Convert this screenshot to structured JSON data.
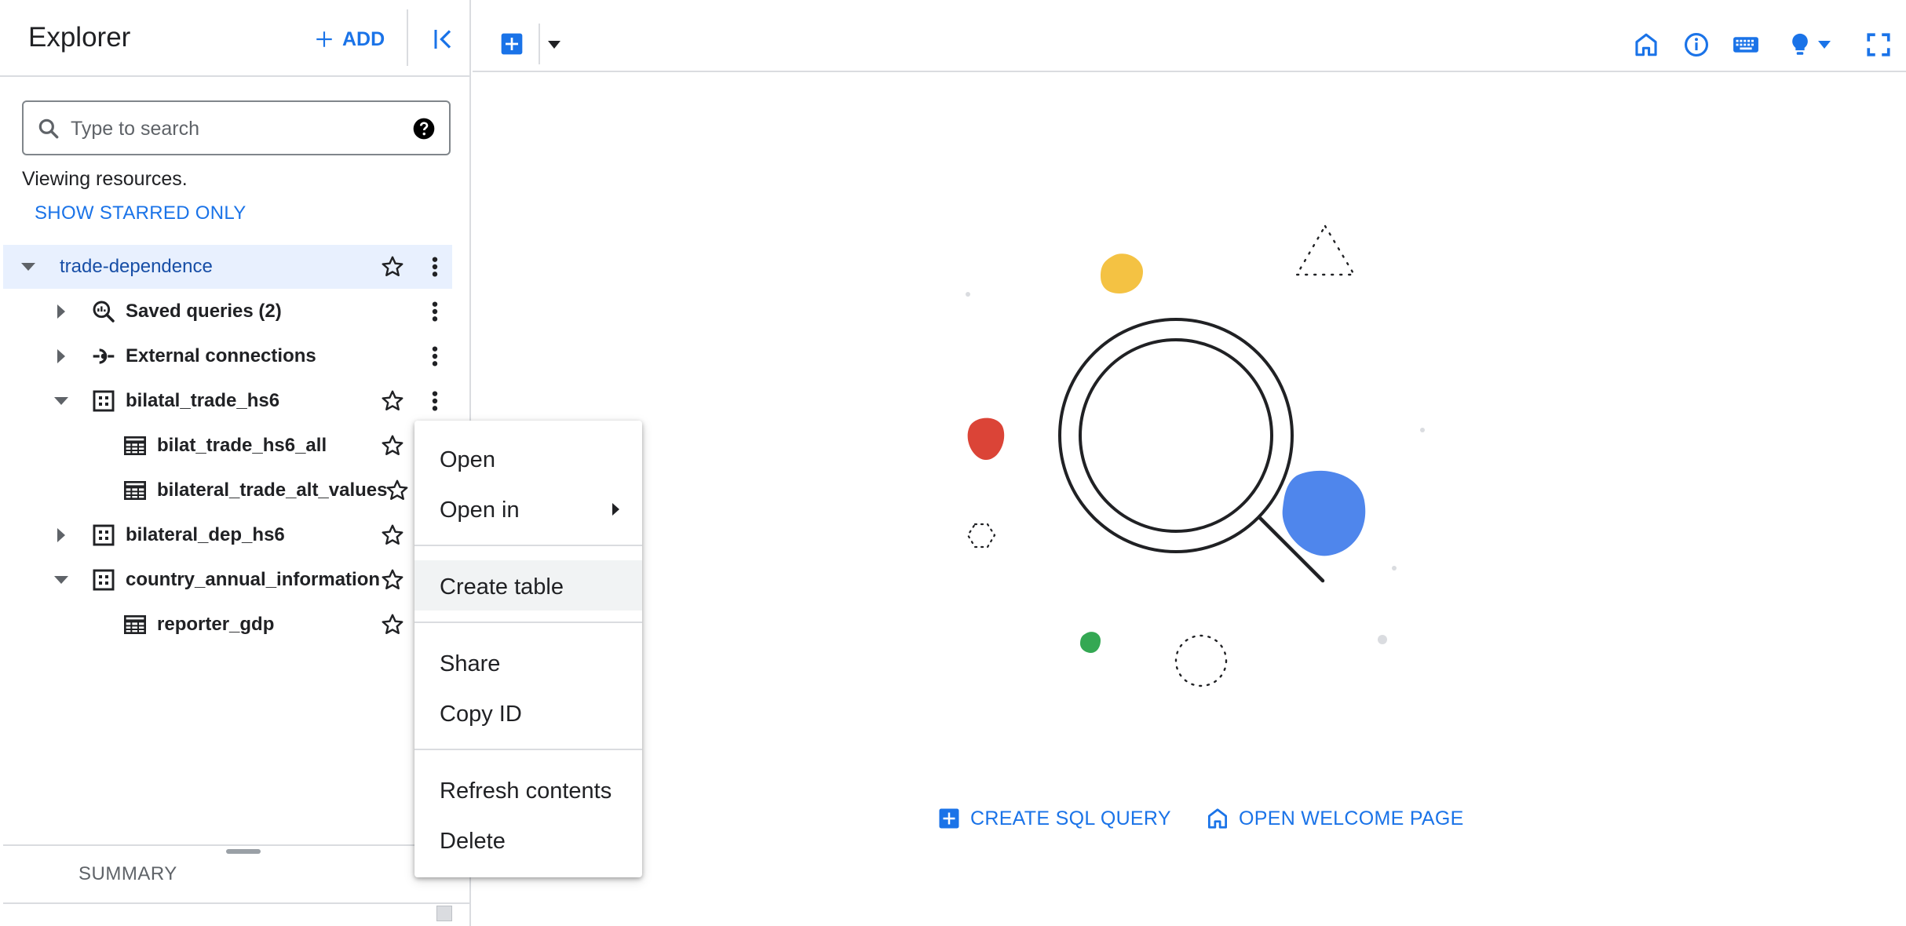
{
  "explorer": {
    "title": "Explorer",
    "add_label": "ADD",
    "search_placeholder": "Type to search",
    "viewing_text": "Viewing resources.",
    "show_starred_label": "SHOW STARRED ONLY"
  },
  "tree": {
    "project": "trade-dependence",
    "saved_queries": "Saved queries (2)",
    "external_connections": "External connections",
    "dataset1": "bilatal_trade_hs6",
    "table1": "bilat_trade_hs6_all",
    "table2": "bilateral_trade_alt_values",
    "dataset2": "bilateral_dep_hs6",
    "dataset3": "country_annual_information",
    "table3": "reporter_gdp"
  },
  "summary": {
    "tab_label": "SUMMARY"
  },
  "context_menu": {
    "open": "Open",
    "open_in": "Open in",
    "create_table": "Create table",
    "share": "Share",
    "copy_id": "Copy ID",
    "refresh": "Refresh contents",
    "delete": "Delete"
  },
  "main": {
    "create_sql_label": "CREATE SQL QUERY",
    "open_welcome_label": "OPEN WELCOME PAGE"
  },
  "colors": {
    "accent": "#1a73e8",
    "selected_row": "#e8f0fe",
    "yellow_blob": "#f4c243",
    "red_blob": "#db4437",
    "blue_blob": "#4f86ec",
    "green_blob": "#34a853"
  },
  "icons": {
    "toolbar": [
      "add-box-icon",
      "chevron-down-icon",
      "home-icon",
      "info-icon",
      "keyboard-icon",
      "lightbulb-icon",
      "fullscreen-icon"
    ]
  }
}
